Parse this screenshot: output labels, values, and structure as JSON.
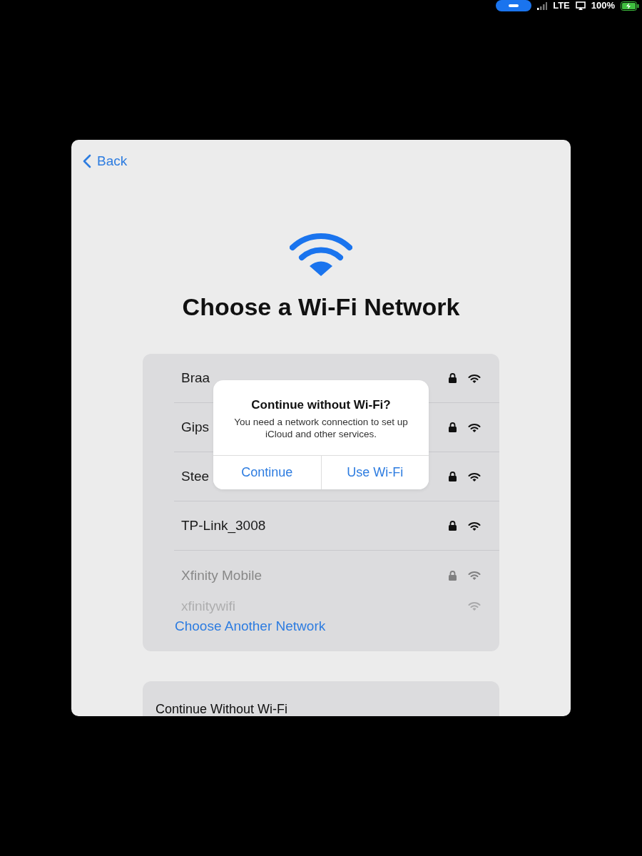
{
  "status_bar": {
    "network": "LTE",
    "battery": "100%",
    "charging": true
  },
  "back": {
    "label": "Back"
  },
  "title": "Choose a Wi-Fi Network",
  "networks": [
    {
      "name": "Braa",
      "locked": true,
      "faded": false
    },
    {
      "name": "Gips",
      "locked": true,
      "faded": false
    },
    {
      "name": "Stee",
      "locked": true,
      "faded": false
    },
    {
      "name": "TP-Link_3008",
      "locked": true,
      "faded": false
    },
    {
      "name": "Xfinity Mobile",
      "locked": true,
      "faded": true
    },
    {
      "name": "xfinitywifi",
      "locked": false,
      "faded": true
    }
  ],
  "other_network": "Choose Another Network",
  "continue_without": "Continue Without Wi-Fi",
  "alert": {
    "title": "Continue without Wi-Fi?",
    "message": "You need a network connection to set up iCloud and other services.",
    "buttons": [
      "Continue",
      "Use Wi-Fi"
    ]
  }
}
